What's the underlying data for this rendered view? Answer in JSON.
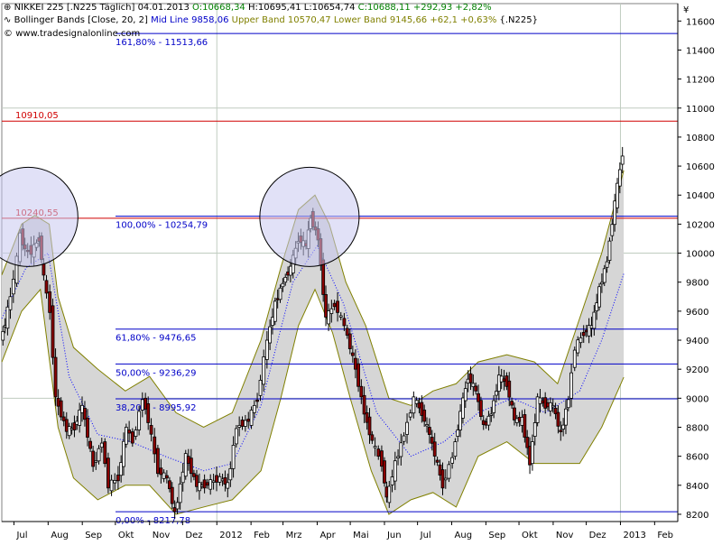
{
  "header": {
    "instrument": "NIKKEI 225 [.N225  Täglich]",
    "date": "04.01.2013",
    "open": "O:10668,34",
    "high": "H:10695,41",
    "low": "L:10654,74",
    "close": "C:10688,11 +292,93 +2,82%",
    "bb_label": "Bollinger Bands [Close, 20, 2]",
    "bb_mid": "Mid Line 9858,06",
    "bb_bands": "Upper Band 10570,47 Lower Band 9145,66 +62,1 +0,63%",
    "bb_symbol": "{.N225}",
    "source": "www.tradesignalonline.com"
  },
  "currency_symbol": "¥",
  "colors": {
    "fib_line": "#0000c8",
    "resistance_line": "#d00000",
    "band_fill": "#d6d6d6",
    "band_edge": "#808000",
    "mid_line": "#0000ff",
    "up_candle": "#ffffff",
    "down_candle": "#8b0000",
    "circle_fill": "#c8c8f0",
    "grid": "#c0ccc0"
  },
  "chart_data": {
    "type": "candlestick",
    "title": "NIKKEI 225",
    "y_axis": {
      "range": [
        8150,
        11720
      ],
      "ticks": [
        8200,
        8400,
        8600,
        8800,
        9000,
        9200,
        9400,
        9600,
        9800,
        10000,
        10200,
        10400,
        10600,
        10800,
        11000,
        11200,
        11400,
        11600
      ],
      "tick_labels": [
        "8200",
        "8400",
        "8600",
        "8800",
        "9000",
        "9200",
        "9400",
        "9600",
        "9800",
        "10000",
        "10200",
        "10400",
        "10600",
        "10800",
        "11000",
        "11200",
        "11400",
        "11600"
      ]
    },
    "x_axis": {
      "range": [
        "2011-06-20",
        "2013-02-22"
      ],
      "ticks": [
        {
          "date": "2011-07-01",
          "label": "Jul"
        },
        {
          "date": "2011-08-01",
          "label": "Aug"
        },
        {
          "date": "2011-09-01",
          "label": "Sep"
        },
        {
          "date": "2011-10-01",
          "label": "Okt"
        },
        {
          "date": "2011-11-01",
          "label": "Nov"
        },
        {
          "date": "2011-12-01",
          "label": "Dez"
        },
        {
          "date": "2012-01-01",
          "label": "2012"
        },
        {
          "date": "2012-02-01",
          "label": "Feb"
        },
        {
          "date": "2012-03-01",
          "label": "Mrz"
        },
        {
          "date": "2012-04-01",
          "label": "Apr"
        },
        {
          "date": "2012-05-01",
          "label": "Mai"
        },
        {
          "date": "2012-06-01",
          "label": "Jun"
        },
        {
          "date": "2012-07-01",
          "label": "Jul"
        },
        {
          "date": "2012-08-01",
          "label": "Aug"
        },
        {
          "date": "2012-09-01",
          "label": "Sep"
        },
        {
          "date": "2012-10-01",
          "label": "Okt"
        },
        {
          "date": "2012-11-01",
          "label": "Nov"
        },
        {
          "date": "2012-12-01",
          "label": "Dez"
        },
        {
          "date": "2013-01-01",
          "label": "2013"
        },
        {
          "date": "2013-02-01",
          "label": "Feb"
        }
      ]
    },
    "fibonacci_levels": [
      {
        "label": "161,80% - 11513,66",
        "value": 11513.66,
        "color": "#0000c8"
      },
      {
        "label": "100,00% - 10254,79",
        "value": 10254.79,
        "color": "#0000c8"
      },
      {
        "label": "61,80% - 9476,65",
        "value": 9476.65,
        "color": "#0000c8"
      },
      {
        "label": "50,00% - 9236,29",
        "value": 9236.29,
        "color": "#0000c8"
      },
      {
        "label": "38,20% - 8995,92",
        "value": 8995.92,
        "color": "#0000c8"
      },
      {
        "label": "0,00% - 8217,78",
        "value": 8217.78,
        "color": "#0000c8"
      }
    ],
    "resistance_levels": [
      {
        "label": "10910,05",
        "value": 10910.05,
        "color": "#d00000"
      },
      {
        "label": "10240,55",
        "value": 10240.55,
        "color": "#d00000"
      }
    ],
    "highlight_circles": [
      {
        "date": "2011-07-14",
        "value": 10250
      },
      {
        "date": "2012-03-25",
        "value": 10250
      }
    ],
    "price_series": {
      "name": "NIKKEI 225",
      "points": [
        {
          "date": "2011-06-20",
          "value": 9400
        },
        {
          "date": "2011-06-24",
          "value": 9520
        },
        {
          "date": "2011-06-29",
          "value": 9700
        },
        {
          "date": "2011-07-05",
          "value": 9960
        },
        {
          "date": "2011-07-08",
          "value": 10130
        },
        {
          "date": "2011-07-12",
          "value": 10020
        },
        {
          "date": "2011-07-18",
          "value": 10010
        },
        {
          "date": "2011-07-25",
          "value": 10100
        },
        {
          "date": "2011-07-29",
          "value": 9830
        },
        {
          "date": "2011-08-04",
          "value": 9600
        },
        {
          "date": "2011-08-09",
          "value": 9000
        },
        {
          "date": "2011-08-19",
          "value": 8780
        },
        {
          "date": "2011-08-26",
          "value": 8800
        },
        {
          "date": "2011-09-02",
          "value": 8950
        },
        {
          "date": "2011-09-12",
          "value": 8530
        },
        {
          "date": "2011-09-20",
          "value": 8700
        },
        {
          "date": "2011-09-26",
          "value": 8400
        },
        {
          "date": "2011-10-05",
          "value": 8450
        },
        {
          "date": "2011-10-12",
          "value": 8800
        },
        {
          "date": "2011-10-18",
          "value": 8700
        },
        {
          "date": "2011-10-27",
          "value": 9000
        },
        {
          "date": "2011-11-01",
          "value": 8850
        },
        {
          "date": "2011-11-10",
          "value": 8500
        },
        {
          "date": "2011-11-18",
          "value": 8450
        },
        {
          "date": "2011-11-25",
          "value": 8200
        },
        {
          "date": "2011-12-05",
          "value": 8600
        },
        {
          "date": "2011-12-15",
          "value": 8400
        },
        {
          "date": "2011-12-22",
          "value": 8400
        },
        {
          "date": "2012-01-05",
          "value": 8450
        },
        {
          "date": "2012-01-12",
          "value": 8400
        },
        {
          "date": "2012-01-20",
          "value": 8800
        },
        {
          "date": "2012-01-31",
          "value": 8850
        },
        {
          "date": "2012-02-08",
          "value": 9000
        },
        {
          "date": "2012-02-17",
          "value": 9400
        },
        {
          "date": "2012-02-24",
          "value": 9650
        },
        {
          "date": "2012-03-02",
          "value": 9800
        },
        {
          "date": "2012-03-09",
          "value": 9900
        },
        {
          "date": "2012-03-16",
          "value": 10100
        },
        {
          "date": "2012-03-23",
          "value": 10050
        },
        {
          "date": "2012-03-27",
          "value": 10250
        },
        {
          "date": "2012-04-03",
          "value": 10100
        },
        {
          "date": "2012-04-10",
          "value": 9550
        },
        {
          "date": "2012-04-18",
          "value": 9650
        },
        {
          "date": "2012-04-27",
          "value": 9500
        },
        {
          "date": "2012-05-07",
          "value": 9200
        },
        {
          "date": "2012-05-15",
          "value": 8900
        },
        {
          "date": "2012-05-22",
          "value": 8700
        },
        {
          "date": "2012-05-31",
          "value": 8550
        },
        {
          "date": "2012-06-04",
          "value": 8300
        },
        {
          "date": "2012-06-12",
          "value": 8550
        },
        {
          "date": "2012-06-20",
          "value": 8750
        },
        {
          "date": "2012-06-29",
          "value": 9000
        },
        {
          "date": "2012-07-06",
          "value": 8900
        },
        {
          "date": "2012-07-13",
          "value": 8750
        },
        {
          "date": "2012-07-25",
          "value": 8400
        },
        {
          "date": "2012-08-03",
          "value": 8600
        },
        {
          "date": "2012-08-10",
          "value": 8900
        },
        {
          "date": "2012-08-17",
          "value": 9150
        },
        {
          "date": "2012-08-24",
          "value": 9050
        },
        {
          "date": "2012-08-31",
          "value": 8800
        },
        {
          "date": "2012-09-07",
          "value": 8900
        },
        {
          "date": "2012-09-14",
          "value": 9150
        },
        {
          "date": "2012-09-21",
          "value": 9100
        },
        {
          "date": "2012-09-28",
          "value": 8850
        },
        {
          "date": "2012-10-05",
          "value": 8850
        },
        {
          "date": "2012-10-12",
          "value": 8550
        },
        {
          "date": "2012-10-19",
          "value": 9000
        },
        {
          "date": "2012-10-26",
          "value": 8950
        },
        {
          "date": "2012-11-02",
          "value": 8950
        },
        {
          "date": "2012-11-09",
          "value": 8750
        },
        {
          "date": "2012-11-16",
          "value": 9000
        },
        {
          "date": "2012-11-22",
          "value": 9350
        },
        {
          "date": "2012-11-30",
          "value": 9450
        },
        {
          "date": "2012-12-07",
          "value": 9500
        },
        {
          "date": "2012-12-14",
          "value": 9750
        },
        {
          "date": "2012-12-21",
          "value": 9950
        },
        {
          "date": "2012-12-28",
          "value": 10350
        },
        {
          "date": "2013-01-04",
          "value": 10688
        }
      ]
    },
    "bollinger_bands": {
      "name": "Bollinger Bands [Close, 20, 2]",
      "upper": [
        {
          "date": "2011-06-20",
          "value": 9850
        },
        {
          "date": "2011-07-08",
          "value": 10200
        },
        {
          "date": "2011-07-20",
          "value": 10260
        },
        {
          "date": "2011-08-02",
          "value": 10200
        },
        {
          "date": "2011-08-10",
          "value": 9700
        },
        {
          "date": "2011-08-24",
          "value": 9350
        },
        {
          "date": "2011-09-15",
          "value": 9200
        },
        {
          "date": "2011-10-10",
          "value": 9050
        },
        {
          "date": "2011-11-01",
          "value": 9150
        },
        {
          "date": "2011-11-25",
          "value": 8900
        },
        {
          "date": "2011-12-20",
          "value": 8800
        },
        {
          "date": "2012-01-15",
          "value": 8900
        },
        {
          "date": "2012-02-10",
          "value": 9400
        },
        {
          "date": "2012-02-28",
          "value": 9900
        },
        {
          "date": "2012-03-15",
          "value": 10300
        },
        {
          "date": "2012-03-30",
          "value": 10400
        },
        {
          "date": "2012-04-12",
          "value": 10200
        },
        {
          "date": "2012-04-27",
          "value": 9800
        },
        {
          "date": "2012-05-15",
          "value": 9500
        },
        {
          "date": "2012-06-05",
          "value": 9000
        },
        {
          "date": "2012-06-25",
          "value": 8950
        },
        {
          "date": "2012-07-15",
          "value": 9050
        },
        {
          "date": "2012-08-05",
          "value": 9100
        },
        {
          "date": "2012-08-25",
          "value": 9250
        },
        {
          "date": "2012-09-20",
          "value": 9300
        },
        {
          "date": "2012-10-15",
          "value": 9250
        },
        {
          "date": "2012-11-05",
          "value": 9100
        },
        {
          "date": "2012-11-25",
          "value": 9550
        },
        {
          "date": "2012-12-15",
          "value": 10000
        },
        {
          "date": "2013-01-04",
          "value": 10570
        }
      ],
      "lower": [
        {
          "date": "2011-06-20",
          "value": 9250
        },
        {
          "date": "2011-07-08",
          "value": 9600
        },
        {
          "date": "2011-07-25",
          "value": 9750
        },
        {
          "date": "2011-08-10",
          "value": 8800
        },
        {
          "date": "2011-08-24",
          "value": 8450
        },
        {
          "date": "2011-09-15",
          "value": 8300
        },
        {
          "date": "2011-10-10",
          "value": 8400
        },
        {
          "date": "2011-11-01",
          "value": 8400
        },
        {
          "date": "2011-11-25",
          "value": 8200
        },
        {
          "date": "2011-12-20",
          "value": 8250
        },
        {
          "date": "2012-01-15",
          "value": 8300
        },
        {
          "date": "2012-02-10",
          "value": 8500
        },
        {
          "date": "2012-02-28",
          "value": 9000
        },
        {
          "date": "2012-03-15",
          "value": 9500
        },
        {
          "date": "2012-03-30",
          "value": 9750
        },
        {
          "date": "2012-04-15",
          "value": 9450
        },
        {
          "date": "2012-05-01",
          "value": 9000
        },
        {
          "date": "2012-05-20",
          "value": 8500
        },
        {
          "date": "2012-06-05",
          "value": 8200
        },
        {
          "date": "2012-06-25",
          "value": 8300
        },
        {
          "date": "2012-07-15",
          "value": 8350
        },
        {
          "date": "2012-08-05",
          "value": 8250
        },
        {
          "date": "2012-08-25",
          "value": 8600
        },
        {
          "date": "2012-09-20",
          "value": 8700
        },
        {
          "date": "2012-10-15",
          "value": 8550
        },
        {
          "date": "2012-11-05",
          "value": 8550
        },
        {
          "date": "2012-11-25",
          "value": 8550
        },
        {
          "date": "2012-12-15",
          "value": 8800
        },
        {
          "date": "2013-01-04",
          "value": 9145
        }
      ],
      "mid": [
        {
          "date": "2011-06-20",
          "value": 9550
        },
        {
          "date": "2011-07-12",
          "value": 9900
        },
        {
          "date": "2011-08-01",
          "value": 10000
        },
        {
          "date": "2011-08-20",
          "value": 9150
        },
        {
          "date": "2011-09-15",
          "value": 8750
        },
        {
          "date": "2011-10-15",
          "value": 8700
        },
        {
          "date": "2011-11-15",
          "value": 8600
        },
        {
          "date": "2011-12-20",
          "value": 8500
        },
        {
          "date": "2012-01-15",
          "value": 8550
        },
        {
          "date": "2012-02-10",
          "value": 8950
        },
        {
          "date": "2012-03-10",
          "value": 9800
        },
        {
          "date": "2012-04-01",
          "value": 10050
        },
        {
          "date": "2012-04-25",
          "value": 9650
        },
        {
          "date": "2012-05-25",
          "value": 8900
        },
        {
          "date": "2012-06-25",
          "value": 8600
        },
        {
          "date": "2012-07-25",
          "value": 8700
        },
        {
          "date": "2012-08-25",
          "value": 8900
        },
        {
          "date": "2012-09-25",
          "value": 9000
        },
        {
          "date": "2012-10-25",
          "value": 8900
        },
        {
          "date": "2012-11-25",
          "value": 9050
        },
        {
          "date": "2012-12-15",
          "value": 9400
        },
        {
          "date": "2013-01-04",
          "value": 9858
        }
      ]
    }
  }
}
